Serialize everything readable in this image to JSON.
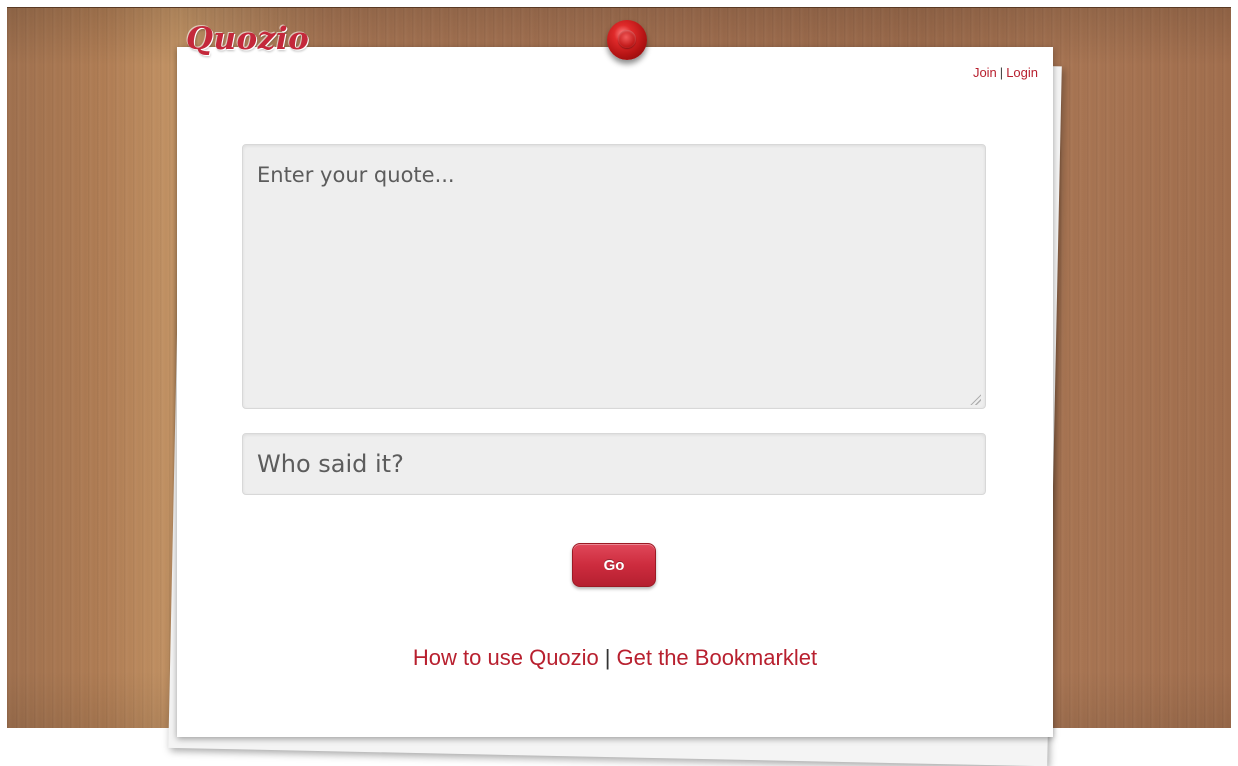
{
  "app": {
    "logo_text": "Quozio"
  },
  "auth": {
    "join_label": "Join",
    "separator": "|",
    "login_label": "Login"
  },
  "form": {
    "quote_placeholder": "Enter your quote...",
    "quote_value": "",
    "author_placeholder": "Who said it?",
    "author_value": "",
    "go_label": "Go"
  },
  "footer": {
    "how_to_label": "How to use Quozio",
    "separator": "|",
    "bookmarklet_label": "Get the Bookmarklet"
  },
  "colors": {
    "accent": "#c4283b",
    "wood": "#a57252",
    "field_bg": "#eeeeee"
  },
  "icons": {
    "pin": "pushpin-icon",
    "resize": "resize-grip-icon"
  }
}
